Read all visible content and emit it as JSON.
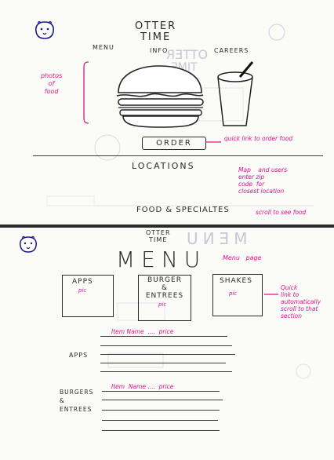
{
  "wire1": {
    "logo_title": "OTTER\nTIME",
    "nav": [
      "MENU",
      "INFO",
      "CAREERS"
    ],
    "order_button": "ORDER",
    "locations": "LOCATIONS",
    "food_specialties": "FOOD & SPECIALTES",
    "notes": {
      "photos": "photos\nof\nfood",
      "order": "quick link to order food",
      "map": "Map    and users\nenter zip\ncode  for\nclosest location",
      "scroll": "scroll to see food"
    }
  },
  "wire2": {
    "logo_title": "OTTER\nTIME",
    "page_title": "MENU",
    "cards": [
      {
        "title": "APPS",
        "pic": "pic"
      },
      {
        "title": "BURGER\n&\nENTREES",
        "pic": "pic"
      },
      {
        "title": "SHAKES",
        "pic": "pic"
      }
    ],
    "sections": [
      {
        "name": "APPS",
        "item_template": "Item Name  ....  price"
      },
      {
        "name": "BURGERS\n&\nENTREES",
        "item_template": "Item  Name ....  price"
      }
    ],
    "notes": {
      "menu_page": "Menu   page",
      "quick_link": "Quick\nlink to\nautomatically\nscroll to that\nsection"
    }
  },
  "colors": {
    "ink": "#2a2a2a",
    "annotation": "#e0148a",
    "bleed": "#c9c6d6"
  },
  "icons": [
    "otter-logo-icon",
    "burger-icon",
    "drink-cup-icon"
  ]
}
